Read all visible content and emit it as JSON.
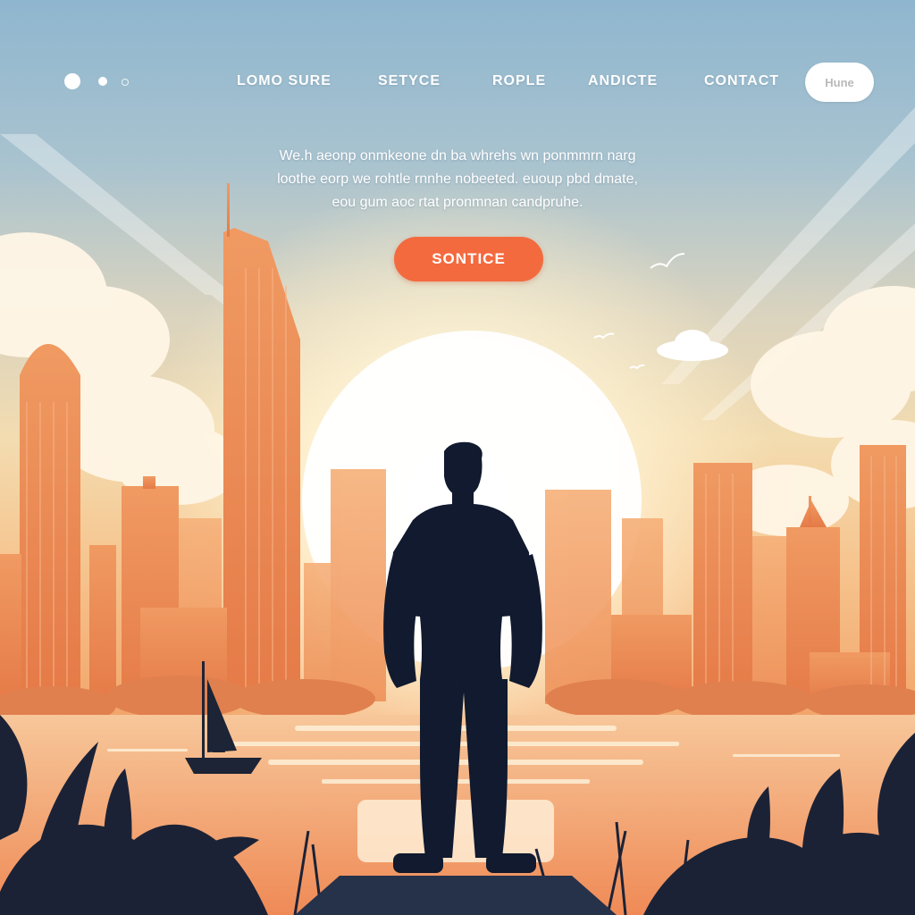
{
  "nav": {
    "links": [
      "LOMO SURE",
      "SETYCE",
      "ROPLE",
      "ANDICTE",
      "CONTACT"
    ],
    "pill_label": "Hune"
  },
  "hero": {
    "lines": [
      "We.h aeonp onmkeone dn ba whrehs wn ponmmrn narg",
      "loothe eorp we rohtle rnnhe nobeeted. euoup pbd dmate,",
      "eou gum aoc rtat pronmnan candpruhe."
    ],
    "cta_label": "SONTICE"
  },
  "colors": {
    "accent": "#f36a3f",
    "sky": "#8fb6cf",
    "silhouette": "#111a2e",
    "building": "#e98a55"
  }
}
